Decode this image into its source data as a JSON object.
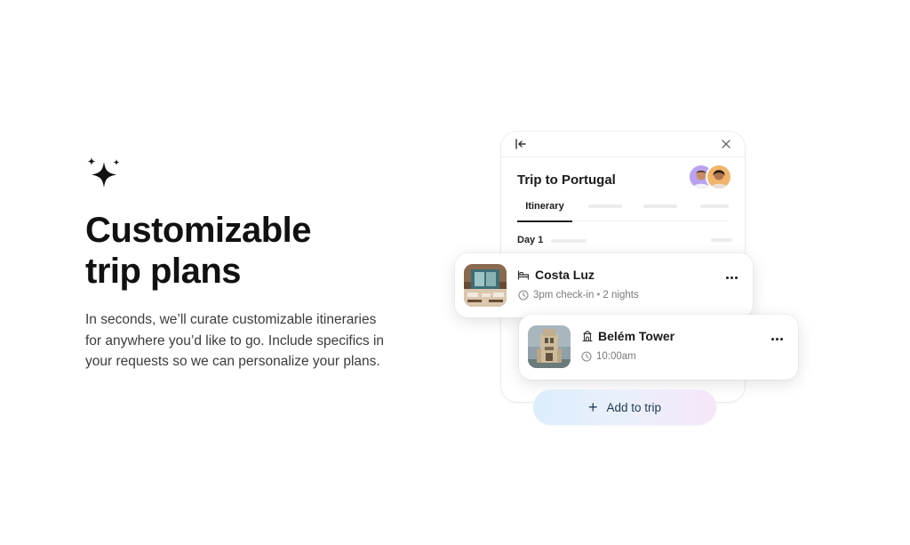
{
  "hero": {
    "icon": "sparkle-icon",
    "headline_line1": "Customizable",
    "headline_line2": "trip plans",
    "body": "In seconds, we’ll curate customizable itineraries for anywhere you’d like to go. Include specifics in your requests so we can personalize your plans."
  },
  "panel": {
    "collapse_icon": "collapse-left-icon",
    "close_icon": "close-icon",
    "title": "Trip to Portugal",
    "avatars": [
      "avatar-traveler-1",
      "avatar-traveler-2"
    ],
    "active_tab": "Itinerary",
    "day_label": "Day 1"
  },
  "cards": [
    {
      "title": "Costa Luz",
      "type_icon": "bed-icon",
      "time_icon": "clock-icon",
      "detail": "3pm check-in",
      "extra": "2 nights",
      "more_icon": "more-icon"
    },
    {
      "title": "Belém Tower",
      "type_icon": "landmark-icon",
      "time_icon": "clock-icon",
      "detail": "10:00am",
      "more_icon": "more-icon"
    }
  ],
  "add_button": {
    "plus": "+",
    "label": "Add to trip"
  },
  "colors": {
    "text": "#111111",
    "button_text": "#1f3b55",
    "button_gradient_start": "#dcedfb",
    "button_gradient_end": "#f6e6f8"
  }
}
